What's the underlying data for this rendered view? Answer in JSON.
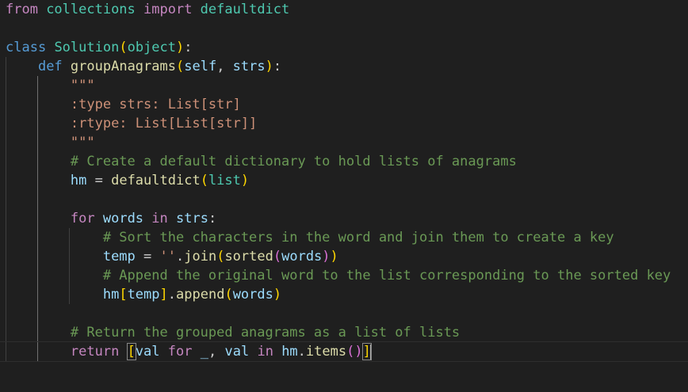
{
  "code": {
    "l1": {
      "kw_from": "from",
      "mod": " collections ",
      "kw_import": "import",
      "name": " defaultdict"
    },
    "l3": {
      "kw_class": "class",
      "cls": "Solution",
      "open": "(",
      "base": "object",
      "close": ")",
      "colon": ":"
    },
    "l4": {
      "kw_def": "def",
      "fn": "groupAnagrams",
      "open": "(",
      "self": "self",
      "comma": ", ",
      "arg": "strs",
      "close": ")",
      "colon": ":"
    },
    "l5": {
      "doc": "\"\"\""
    },
    "l6": {
      "doc": ":type strs: List[str]"
    },
    "l7": {
      "doc": ":rtype: List[List[str]]"
    },
    "l8": {
      "doc": "\"\"\""
    },
    "l9": {
      "comment": "# Create a default dictionary to hold lists of anagrams"
    },
    "l10": {
      "var": "hm",
      "eq": " = ",
      "fn": "defaultdict",
      "open": "(",
      "arg": "list",
      "close": ")"
    },
    "l12": {
      "kw_for": "for",
      "var": "words",
      "kw_in": "in",
      "iter": "strs",
      "colon": ":"
    },
    "l13": {
      "comment": "# Sort the characters in the word and join them to create a key"
    },
    "l14": {
      "var": "temp",
      "eq": " = ",
      "str": "''",
      "dot": ".",
      "fn": "join",
      "open": "(",
      "fn2": "sorted",
      "open2": "(",
      "arg": "words",
      "close2": ")",
      "close": ")"
    },
    "l15": {
      "comment": "# Append the original word to the list corresponding to the sorted key"
    },
    "l16": {
      "var": "hm",
      "lb": "[",
      "key": "temp",
      "rb": "]",
      "dot": ".",
      "fn": "append",
      "open": "(",
      "arg": "words",
      "close": ")"
    },
    "l18": {
      "comment": "# Return the grouped anagrams as a list of lists"
    },
    "l19": {
      "kw_return": "return",
      "lb": "[",
      "v1": "val",
      "kw_for": "for",
      "under": "_",
      "comma": ", ",
      "v2": "val",
      "kw_in": "in",
      "obj": "hm",
      "dot": ".",
      "fn": "items",
      "open": "(",
      "close": ")",
      "rb": "]"
    }
  },
  "colors": {
    "background": "#1f1f1f",
    "keyword": "#c586c0",
    "storage": "#569cd6",
    "function": "#dcdcaa",
    "class": "#4ec9b0",
    "variable": "#9cdcfe",
    "string": "#ce9178",
    "comment": "#6a9955"
  }
}
